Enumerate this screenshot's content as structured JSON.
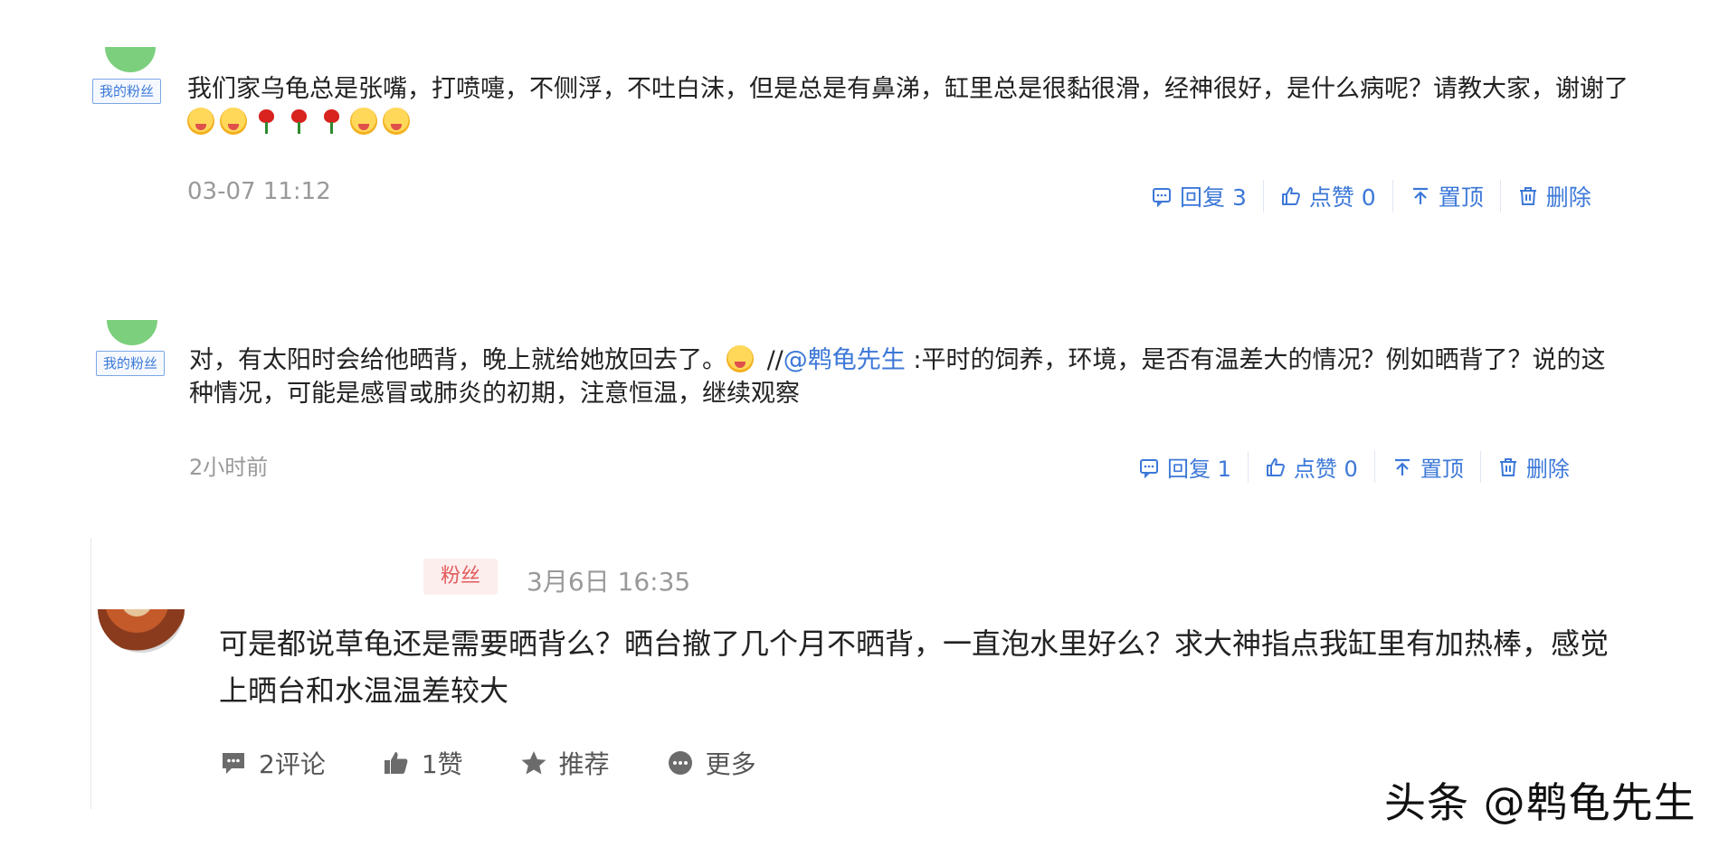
{
  "comments": [
    {
      "tag": "我的粉丝",
      "text": "我们家乌龟总是张嘴，打喷嚏，不侧浮，不吐白沫，但是总是有鼻涕，缸里总是很黏很滑，经神很好，是什么病呢？请教大家，谢谢了",
      "time": "03-07 11:12",
      "actions": {
        "reply": "回复 3",
        "like": "点赞 0",
        "pin": "置顶",
        "delete": "删除"
      }
    },
    {
      "tag": "我的粉丝",
      "text_before": "对，有太阳时会给他晒背，晚上就给她放回去了。",
      "quote_sep": " //",
      "mention": "@鹎龟先生",
      "text_after": " :平时的饲养，环境，是否有温差大的情况？例如晒背了？说的这种情况，可能是感冒或肺炎的初期，注意恒温，继续观察",
      "time": "2小时前",
      "actions": {
        "reply": "回复 1",
        "like": "点赞 0",
        "pin": "置顶",
        "delete": "删除"
      }
    }
  ],
  "post": {
    "badge": "粉丝",
    "time": "3月6日 16:35",
    "text": "可是都说草龟还是需要晒背么？晒台撤了几个月不晒背，一直泡水里好么？求大神指点我缸里有加热棒，感觉上晒台和水温温差较大",
    "actions": {
      "comment": "2评论",
      "like": "1赞",
      "recommend": "推荐",
      "more": "更多"
    }
  },
  "watermark": "头条 @鹎龟先生",
  "colors": {
    "link": "#3c78d8",
    "muted": "#999999",
    "badge_bg": "#fdeeee",
    "badge_text": "#e25b5b"
  }
}
